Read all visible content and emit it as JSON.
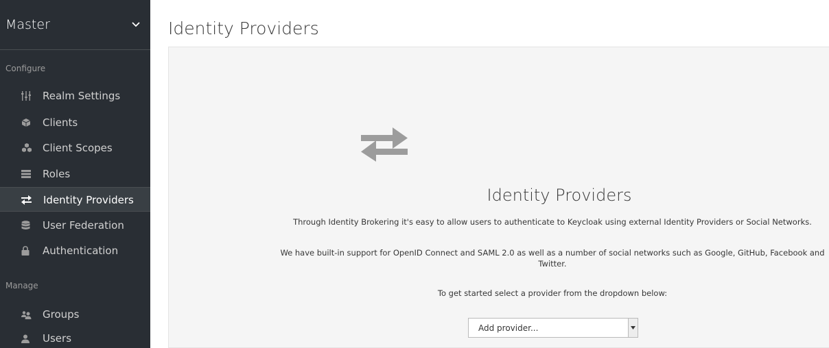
{
  "sidebar": {
    "realm": "Master",
    "configure_label": "Configure",
    "manage_label": "Manage",
    "configure_items": [
      {
        "label": "Realm Settings",
        "icon": "sliders-icon"
      },
      {
        "label": "Clients",
        "icon": "cube-icon"
      },
      {
        "label": "Client Scopes",
        "icon": "cubes-icon"
      },
      {
        "label": "Roles",
        "icon": "list-icon"
      },
      {
        "label": "Identity Providers",
        "icon": "exchange-icon",
        "active": true
      },
      {
        "label": "User Federation",
        "icon": "database-icon"
      },
      {
        "label": "Authentication",
        "icon": "lock-icon"
      }
    ],
    "manage_items": [
      {
        "label": "Groups",
        "icon": "users-icon"
      },
      {
        "label": "Users",
        "icon": "user-icon"
      }
    ]
  },
  "main": {
    "title": "Identity Providers",
    "empty_state": {
      "icon": "exchange-icon",
      "title": "Identity Providers",
      "line1": "Through Identity Brokering it's easy to allow users to authenticate to Keycloak using external Identity Providers or Social Networks.",
      "line2": "We have built-in support for OpenID Connect and SAML 2.0 as well as a number of social networks such as Google, GitHub, Facebook and Twitter.",
      "line3": "To get started select a provider from the dropdown below:",
      "select_value": "Add provider..."
    }
  },
  "colors": {
    "sidebar_bg": "#292e34",
    "sidebar_active_bg": "#393f44",
    "panel_bg": "#f5f5f5",
    "icon_gray": "#9c9c9c"
  }
}
